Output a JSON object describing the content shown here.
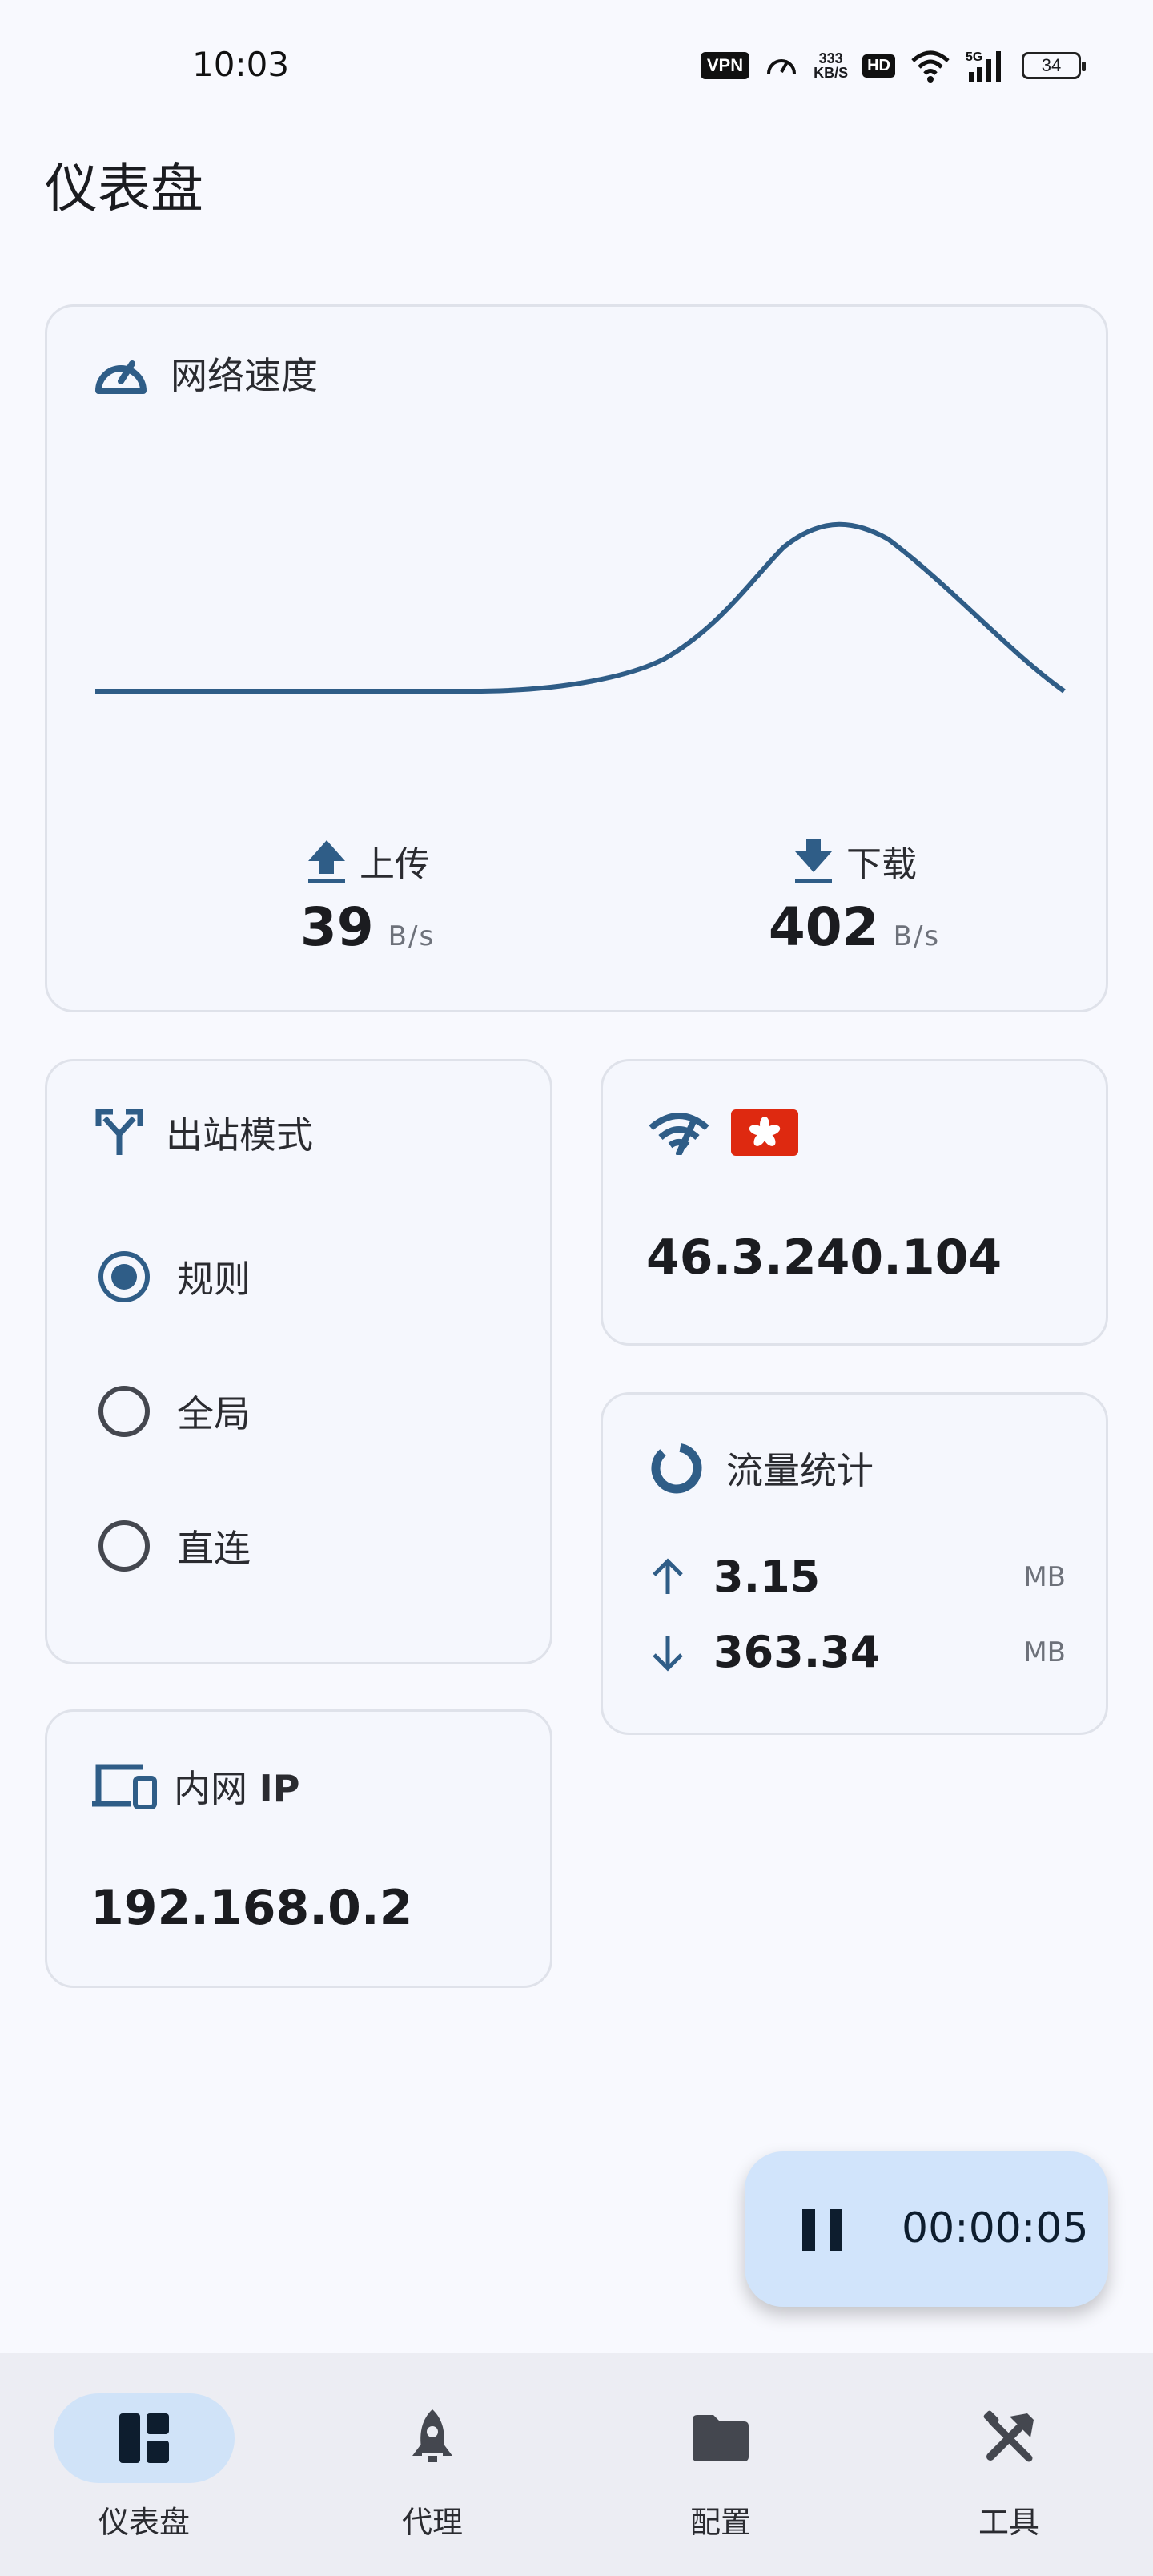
{
  "status_bar": {
    "time": "10:03",
    "vpn": "VPN",
    "net_speed_value": "333",
    "net_speed_unit": "KB/S",
    "hd": "HD",
    "network": "5G",
    "battery": "34"
  },
  "page": {
    "title": "仪表盘"
  },
  "speed_card": {
    "title": "网络速度",
    "icon": "speedometer-icon",
    "upload": {
      "label": "上传",
      "value": "39",
      "unit": "B/s"
    },
    "download": {
      "label": "下载",
      "value": "402",
      "unit": "B/s"
    }
  },
  "mode_card": {
    "title": "出站模式",
    "icon": "fork-arrows-icon",
    "options": [
      {
        "label": "规则",
        "checked": true
      },
      {
        "label": "全局",
        "checked": false
      },
      {
        "label": "直连",
        "checked": false
      }
    ]
  },
  "ip_card": {
    "icon": "wifi-signal-icon",
    "flag": "hong-kong-flag-icon",
    "ip": "46.3.240.104"
  },
  "traffic_card": {
    "title": "流量统计",
    "icon": "donut-chart-icon",
    "upload": {
      "value": "3.15",
      "unit": "MB"
    },
    "download": {
      "value": "363.34",
      "unit": "MB"
    }
  },
  "lan_card": {
    "title_prefix": "内网",
    "title_suffix": "IP",
    "icon": "devices-icon",
    "ip": "192.168.0.2"
  },
  "fab": {
    "icon": "pause-icon",
    "timer": "00:00:05"
  },
  "bottom_nav": [
    {
      "label": "仪表盘",
      "icon": "dashboard-icon",
      "active": true
    },
    {
      "label": "代理",
      "icon": "rocket-icon",
      "active": false
    },
    {
      "label": "配置",
      "icon": "folder-icon",
      "active": false
    },
    {
      "label": "工具",
      "icon": "tools-icon",
      "active": false
    }
  ],
  "colors": {
    "accent": "#2f5d87",
    "background": "#f8f9fe",
    "card": "#f5f7fd",
    "fab": "#d1e4fb",
    "nav_active": "#d0e3f8"
  }
}
